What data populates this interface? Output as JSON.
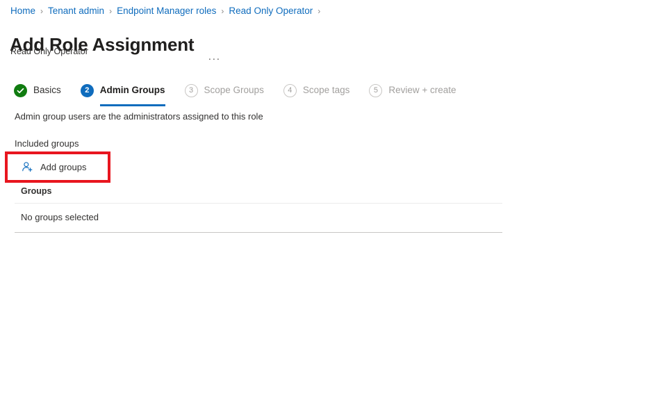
{
  "breadcrumb": {
    "separator": "›",
    "items": [
      {
        "label": "Home"
      },
      {
        "label": "Tenant admin"
      },
      {
        "label": "Endpoint Manager roles"
      },
      {
        "label": "Read Only Operator"
      }
    ],
    "trailing_separator": "›"
  },
  "header": {
    "title": "Add Role Assignment",
    "subtitle": "Read Only Operator",
    "more_menu": "···"
  },
  "wizard": {
    "steps": [
      {
        "badge": "check-icon",
        "label": "Basics",
        "state": "completed"
      },
      {
        "badge": "2",
        "label": "Admin Groups",
        "state": "active"
      },
      {
        "badge": "3",
        "label": "Scope Groups",
        "state": "todo"
      },
      {
        "badge": "4",
        "label": "Scope tags",
        "state": "todo"
      },
      {
        "badge": "5",
        "label": "Review + create",
        "state": "todo"
      }
    ]
  },
  "main": {
    "description": "Admin group users are the administrators assigned to this role",
    "section_label": "Included groups",
    "add_groups": {
      "label": "Add groups",
      "icon": "add-user-icon"
    },
    "table": {
      "column_header": "Groups",
      "empty_message": "No groups selected"
    }
  },
  "annotation": {
    "highlight_color": "#e8161f",
    "target": "Add groups"
  },
  "colors": {
    "link": "#0f6cbd",
    "accent": "#0f6cbd",
    "success": "#107c10",
    "disabled_text": "#a19f9d",
    "highlight": "#e8161f"
  }
}
